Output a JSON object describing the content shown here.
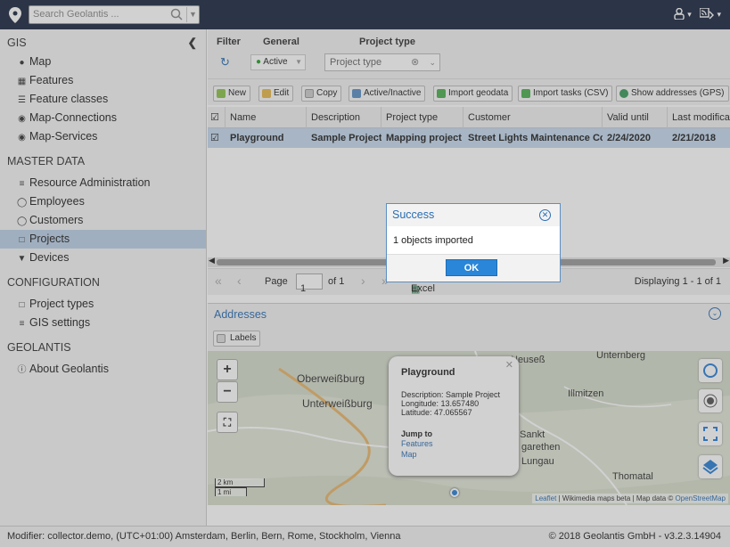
{
  "search": {
    "placeholder": "Search Geolantis ..."
  },
  "sidebar": {
    "sections": [
      {
        "title": "GIS",
        "items": [
          {
            "label": "Map",
            "icon": "marker-icon"
          },
          {
            "label": "Features",
            "icon": "features-icon"
          },
          {
            "label": "Feature classes",
            "icon": "list-icon"
          },
          {
            "label": "Map-Connections",
            "icon": "globe-icon"
          },
          {
            "label": "Map-Services",
            "icon": "globe-icon"
          }
        ]
      },
      {
        "title": "MASTER DATA",
        "items": [
          {
            "label": "Resource Administration",
            "icon": "sliders-icon"
          },
          {
            "label": "Employees",
            "icon": "user-icon"
          },
          {
            "label": "Customers",
            "icon": "users-icon"
          },
          {
            "label": "Projects",
            "icon": "folder-icon"
          },
          {
            "label": "Devices",
            "icon": "wifi-icon"
          }
        ]
      },
      {
        "title": "CONFIGURATION",
        "items": [
          {
            "label": "Project types",
            "icon": "folder-icon"
          },
          {
            "label": "GIS settings",
            "icon": "sliders-icon"
          }
        ]
      },
      {
        "title": "GEOLANTIS",
        "items": [
          {
            "label": "About Geolantis",
            "icon": "info-icon"
          }
        ]
      }
    ]
  },
  "filter": {
    "label": "Filter",
    "general_label": "General",
    "project_type_label": "Project type",
    "active_value": "Active",
    "project_type_placeholder": "Project type"
  },
  "toolbar": {
    "new": "New",
    "edit": "Edit",
    "copy": "Copy",
    "active_inactive": "Active/Inactive",
    "import_geodata": "Import geodata",
    "import_tasks": "Import tasks (CSV)",
    "show_addresses": "Show addresses (GPS)"
  },
  "grid": {
    "columns": [
      "Name",
      "Description",
      "Project type",
      "Customer",
      "Valid until",
      "Last modificat"
    ],
    "rows": [
      [
        "Playground",
        "Sample Project",
        "Mapping project",
        "Street Lights Maintenance Co.",
        "2/24/2020",
        "2/21/2018"
      ]
    ]
  },
  "pager": {
    "page_label": "Page",
    "page_value": "1",
    "of_label": "of 1",
    "export_label": "Excel",
    "displaying": "Displaying 1 - 1 of 1"
  },
  "addresses": {
    "title": "Addresses",
    "labels_button": "Labels"
  },
  "map": {
    "places": [
      "Oberweißburg",
      "Unterweißburg",
      "Unternberg",
      "Illmitzen",
      "Thomatal",
      "Sankt",
      "garethen",
      "Lungau",
      "Neuseß"
    ],
    "scale_km": "2 km",
    "scale_mi": "1 mi",
    "popup": {
      "title": "Playground",
      "description": "Description: Sample Project",
      "longitude": "Longitude: 13.657480",
      "latitude": "Latitude: 47.065567",
      "jump_to": "Jump to",
      "link_features": "Features",
      "link_map": "Map"
    },
    "attribution_leaflet": "Leaflet",
    "attribution_text": " | Wikimedia maps beta | Map data © ",
    "attribution_osm": "OpenStreetMap"
  },
  "footer": {
    "left": "Modifier: collector.demo, (UTC+01:00) Amsterdam, Berlin, Bern, Rome, Stockholm, Vienna",
    "right": "© 2018 Geolantis GmbH - v3.2.3.14904"
  },
  "dialog": {
    "title": "Success",
    "message": "1 objects imported",
    "ok": "OK"
  },
  "colors": {
    "topbar": "#1b2740",
    "accent": "#2a6db3",
    "selected_row": "#c5d8ee",
    "ok_button": "#2a86d8"
  }
}
